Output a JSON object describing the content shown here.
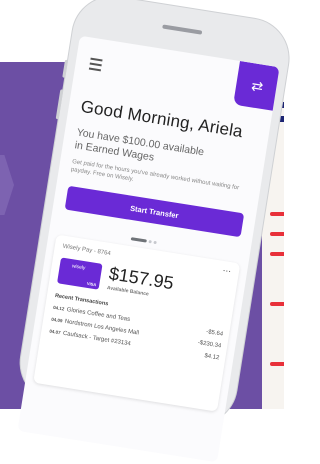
{
  "screen": {
    "greeting": "Good Morning, Ariela",
    "earned_line_1": "You have $100.00 available",
    "earned_line_2": "in Earned Wages",
    "sub_note": "Get paid for the hours you've already worked without waiting for payday. Free on Wisely.",
    "start_transfer_label": "Start Transfer",
    "transfer_icon": "swap-arrows-icon"
  },
  "card": {
    "account_label": "Wisely Pay - 8764",
    "more_label": "...",
    "card_logo": "wisely",
    "card_network": "VISA",
    "balance": "$157.95",
    "balance_label": "Available Balance",
    "recent_title": "Recent Transactions",
    "transactions": [
      {
        "date": "04.12",
        "desc": "Glories Coffee and Teas",
        "amount": "-$5.64"
      },
      {
        "date": "04.09",
        "desc": "Nordstrom Los Angeles Mall",
        "amount": "-$230.34"
      },
      {
        "date": "04.07",
        "desc": "Caufsack - Target #23134",
        "amount": "$4.12"
      }
    ]
  },
  "colors": {
    "background_purple": "#6c4fa4",
    "accent_purple": "#6a2ad6",
    "deco_navy": "#1c2472",
    "deco_red": "#e8303a"
  }
}
